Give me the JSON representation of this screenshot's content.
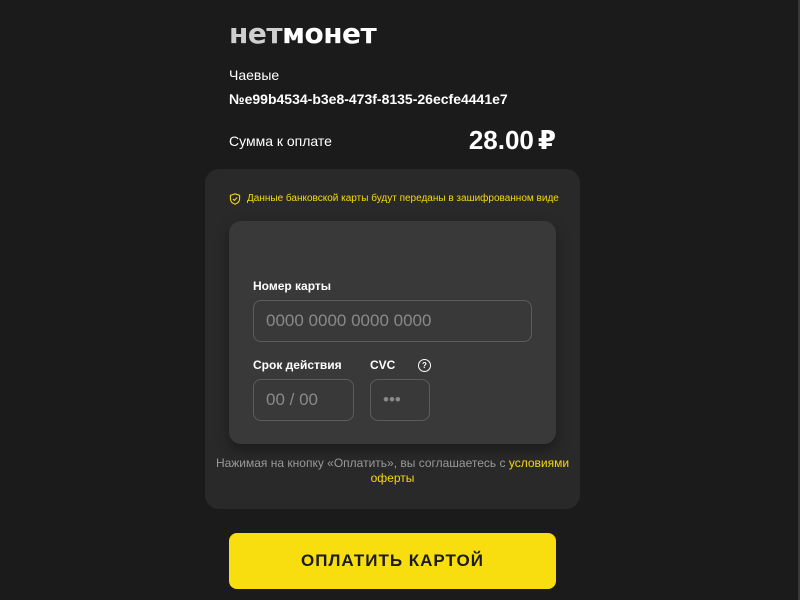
{
  "brand": {
    "logo_part1": "нет",
    "logo_part2": "монет"
  },
  "payment": {
    "purpose": "Чаевые",
    "order_id": "№e99b4534-b3e8-473f-8135-26ecfe4441e7",
    "amount_label": "Сумма к оплате",
    "amount": "28.00",
    "currency": "₽"
  },
  "secure_note": {
    "text": "Данные банковской карты будут переданы в зашифрованном виде",
    "icon": "shield-check-icon"
  },
  "card_form": {
    "number_label": "Номер карты",
    "number_placeholder": "0000 0000 0000 0000",
    "expiry_label": "Срок действия",
    "expiry_placeholder": "00 / 00",
    "cvc_label": "CVC",
    "cvc_help_icon": "question-icon",
    "cvc_help_text": "?",
    "cvc_placeholder": "•••"
  },
  "consent": {
    "text_before": "Нажимая на кнопку «Оплатить», вы соглашаетесь с ",
    "link_text": "условиями оферты"
  },
  "pay_button_label": "ОПЛАТИТЬ КАРТОЙ",
  "colors": {
    "background": "#1c1b1c",
    "panel": "#2a292a",
    "card": "#3a393a",
    "accent": "#f8de0e"
  }
}
